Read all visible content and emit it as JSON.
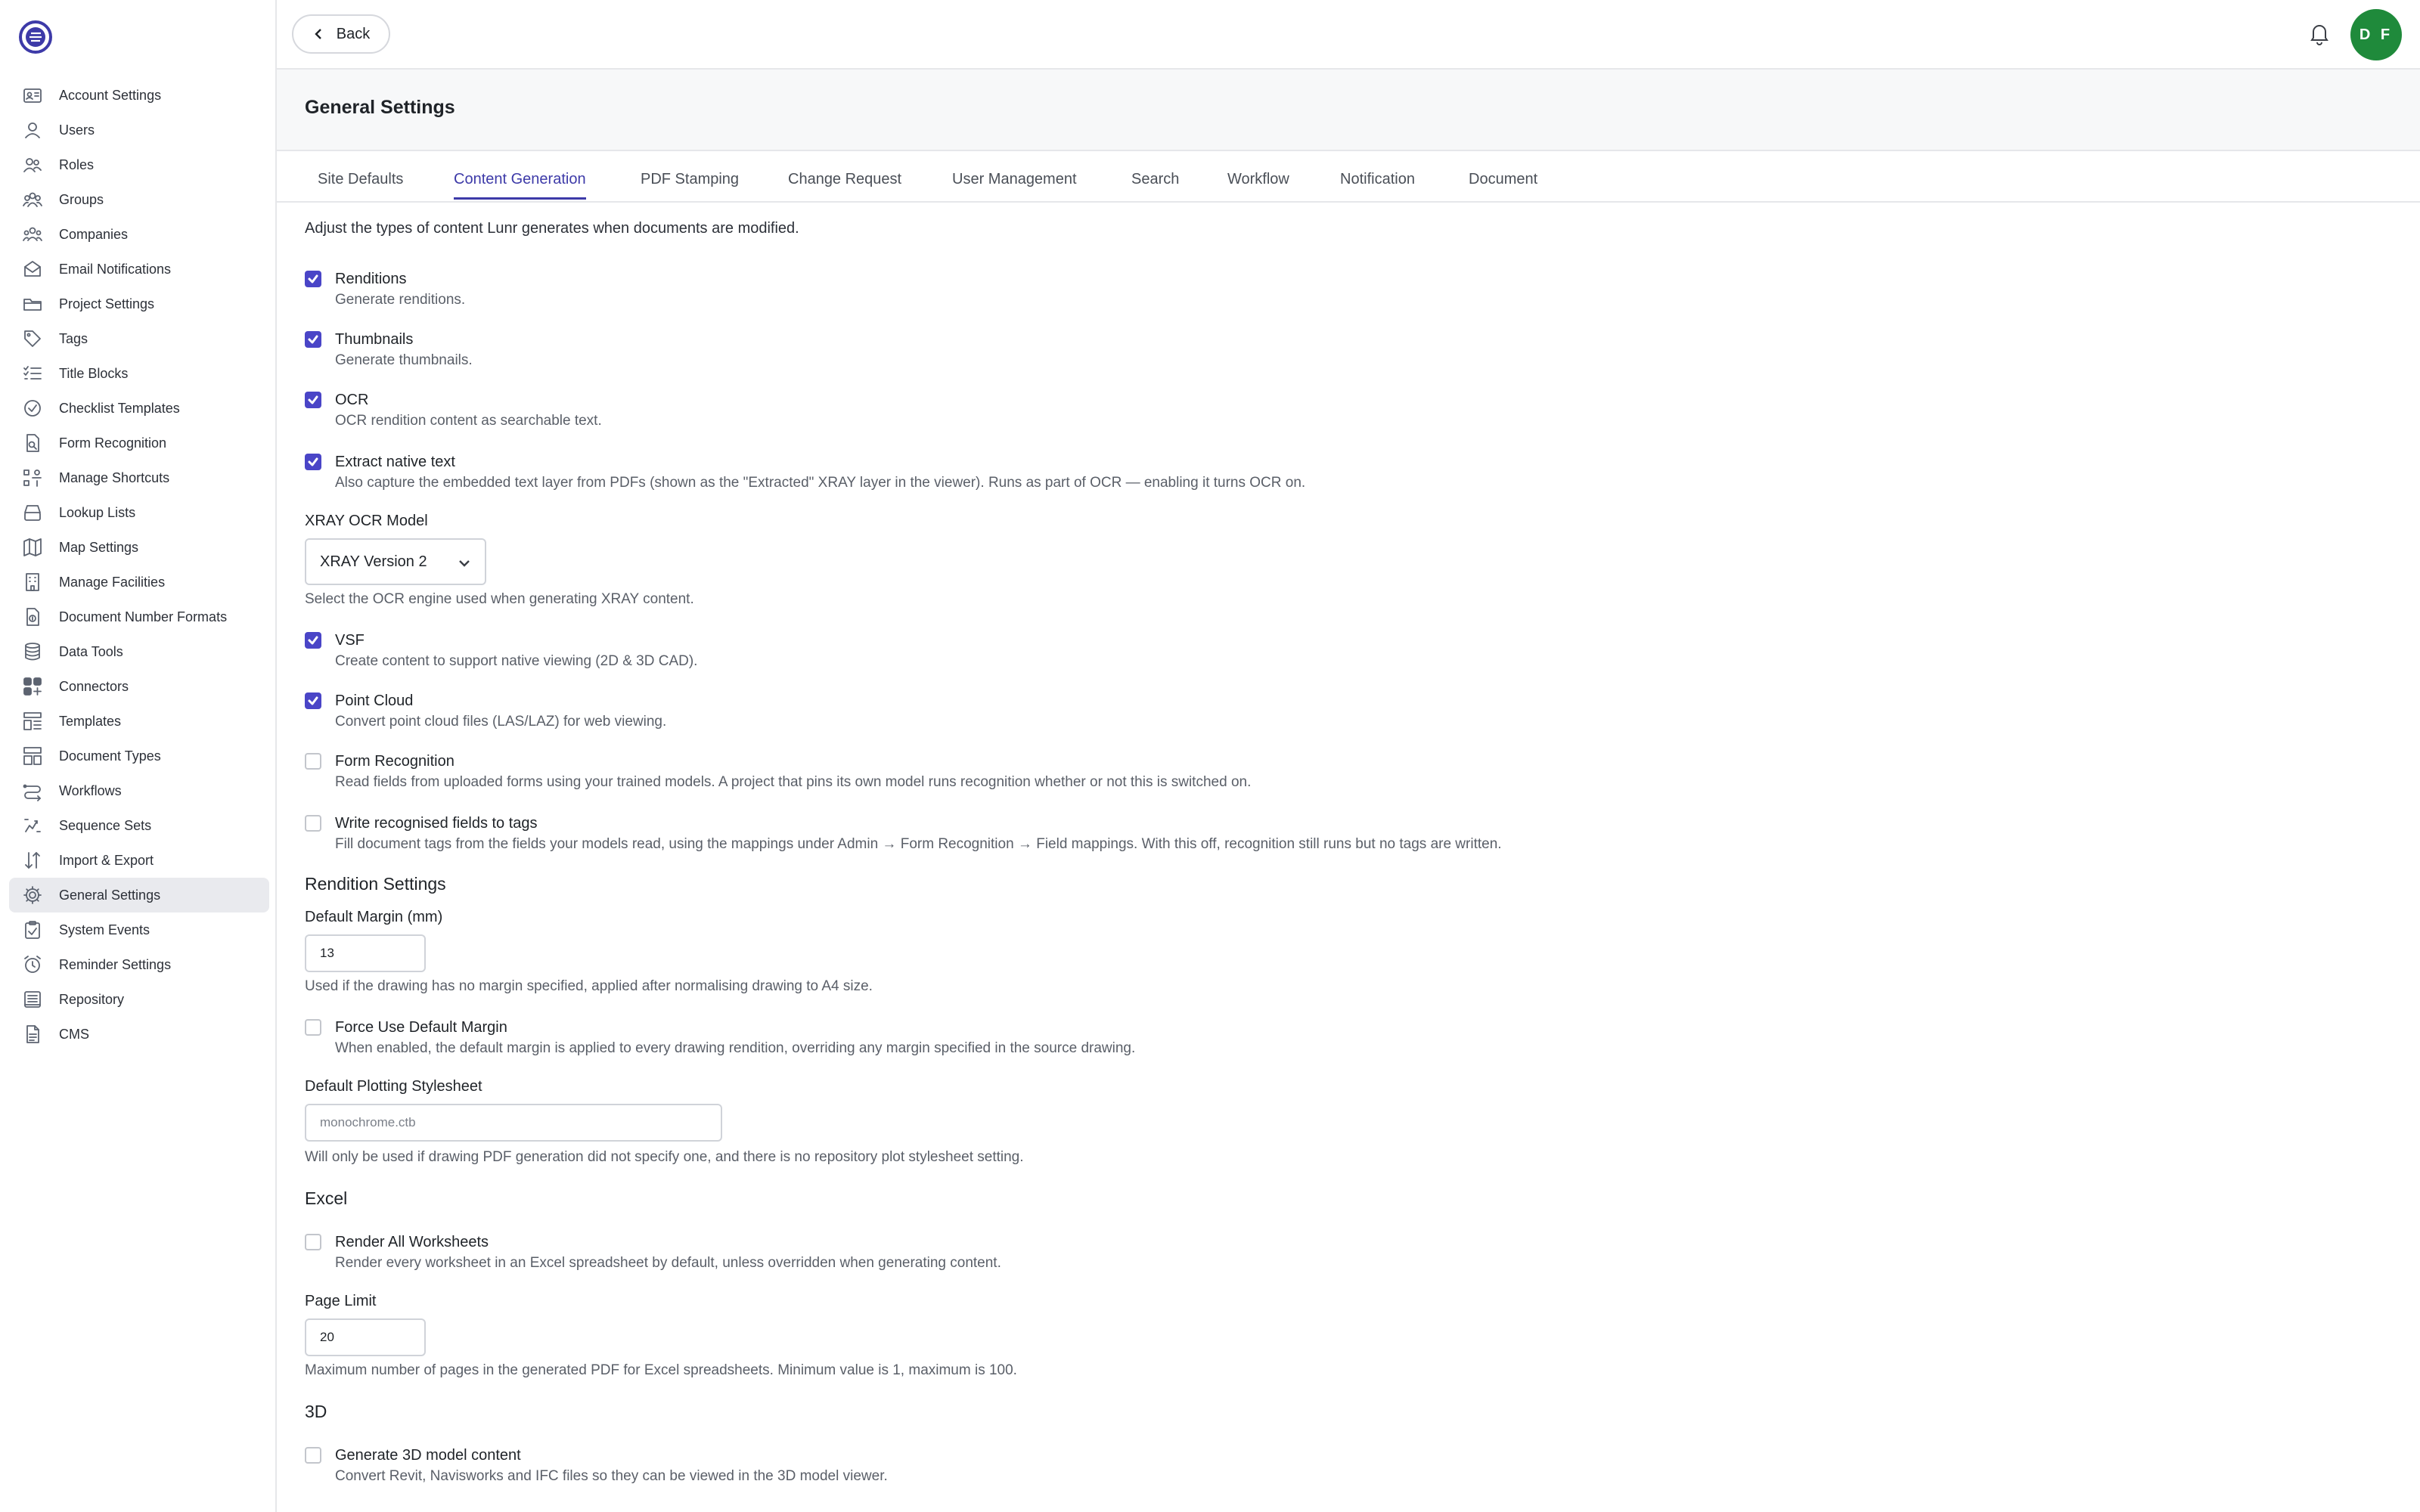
{
  "sidebar": {
    "items": [
      {
        "label": "Account Settings",
        "icon": "account-card-icon"
      },
      {
        "label": "Users",
        "icon": "user-icon"
      },
      {
        "label": "Roles",
        "icon": "roles-icon"
      },
      {
        "label": "Groups",
        "icon": "groups-icon"
      },
      {
        "label": "Companies",
        "icon": "companies-icon"
      },
      {
        "label": "Email Notifications",
        "icon": "envelope-icon"
      },
      {
        "label": "Project Settings",
        "icon": "folder-icon"
      },
      {
        "label": "Tags",
        "icon": "tag-icon"
      },
      {
        "label": "Title Blocks",
        "icon": "list-icon"
      },
      {
        "label": "Checklist Templates",
        "icon": "check-circle-icon"
      },
      {
        "label": "Form Recognition",
        "icon": "document-search-icon"
      },
      {
        "label": "Manage Shortcuts",
        "icon": "shortcuts-icon"
      },
      {
        "label": "Lookup Lists",
        "icon": "tray-icon"
      },
      {
        "label": "Map Settings",
        "icon": "map-icon"
      },
      {
        "label": "Manage Facilities",
        "icon": "building-icon"
      },
      {
        "label": "Document Number Formats",
        "icon": "document-number-icon"
      },
      {
        "label": "Data Tools",
        "icon": "database-icon"
      },
      {
        "label": "Connectors",
        "icon": "grid-plus-icon"
      },
      {
        "label": "Templates",
        "icon": "template-icon"
      },
      {
        "label": "Document Types",
        "icon": "layout-icon"
      },
      {
        "label": "Workflows",
        "icon": "workflow-icon"
      },
      {
        "label": "Sequence Sets",
        "icon": "sequence-icon"
      },
      {
        "label": "Import & Export",
        "icon": "arrows-up-down-icon"
      },
      {
        "label": "General Settings",
        "icon": "gear-icon"
      },
      {
        "label": "System Events",
        "icon": "clipboard-check-icon"
      },
      {
        "label": "Reminder Settings",
        "icon": "alarm-clock-icon"
      },
      {
        "label": "Repository",
        "icon": "repository-icon"
      },
      {
        "label": "CMS",
        "icon": "file-text-icon"
      }
    ],
    "active_index": 23
  },
  "topbar": {
    "back_label": "Back",
    "avatar_initials": "D F"
  },
  "header": {
    "title": "General Settings"
  },
  "tabs": [
    {
      "label": "Site Defaults"
    },
    {
      "label": "Content Generation"
    },
    {
      "label": "PDF Stamping"
    },
    {
      "label": "Change Request"
    },
    {
      "label": "User Management"
    },
    {
      "label": "Search"
    },
    {
      "label": "Workflow"
    },
    {
      "label": "Notification"
    },
    {
      "label": "Document"
    }
  ],
  "active_tab": 1,
  "content": {
    "intro": "Adjust the types of content Lunr generates when documents are modified.",
    "renditions": {
      "label": "Renditions",
      "desc": "Generate renditions.",
      "checked": true
    },
    "thumbnails": {
      "label": "Thumbnails",
      "desc": "Generate thumbnails.",
      "checked": true
    },
    "ocr": {
      "label": "OCR",
      "desc": "OCR rendition content as searchable text.",
      "checked": true
    },
    "extract_native": {
      "label": "Extract native text",
      "desc": "Also capture the embedded text layer from PDFs (shown as the \"Extracted\" XRAY layer in the viewer). Runs as part of OCR — enabling it turns OCR on.",
      "checked": true
    },
    "xray_model": {
      "label": "XRAY OCR Model",
      "value": "XRAY Version 2",
      "help": "Select the OCR engine used when generating XRAY content."
    },
    "vsf": {
      "label": "VSF",
      "desc": "Create content to support native viewing (2D & 3D CAD).",
      "checked": true
    },
    "point_cloud": {
      "label": "Point Cloud",
      "desc": "Convert point cloud files (LAS/LAZ) for web viewing.",
      "checked": true
    },
    "form_recognition": {
      "label": "Form Recognition",
      "desc": "Read fields from uploaded forms using your trained models. A project that pins its own model runs recognition whether or not this is switched on.",
      "checked": false
    },
    "write_fields": {
      "label": "Write recognised fields to tags",
      "desc": "Fill document tags from the fields your models read, using the mappings under Admin → Form Recognition → Field mappings. With this off, recognition still runs but no tags are written.",
      "checked": false
    },
    "rendition_section": "Rendition Settings",
    "default_margin": {
      "label": "Default Margin (mm)",
      "value": "13",
      "help": "Used if the drawing has no margin specified, applied after normalising drawing to A4 size."
    },
    "force_margin": {
      "label": "Force Use Default Margin",
      "desc": "When enabled, the default margin is applied to every drawing rendition, overriding any margin specified in the source drawing.",
      "checked": false
    },
    "stylesheet": {
      "label": "Default Plotting Stylesheet",
      "placeholder": "monochrome.ctb",
      "help": "Will only be used if drawing PDF generation did not specify one, and there is no repository plot stylesheet setting."
    },
    "excel_section": "Excel",
    "render_all": {
      "label": "Render All Worksheets",
      "desc": "Render every worksheet in an Excel spreadsheet by default, unless overridden when generating content.",
      "checked": false
    },
    "page_limit": {
      "label": "Page Limit",
      "value": "20",
      "help": "Maximum number of pages in the generated PDF for Excel spreadsheets. Minimum value is 1, maximum is 100."
    },
    "threed_section": "3D",
    "generate_3d": {
      "label": "Generate 3D model content",
      "desc": "Convert Revit, Navisworks and IFC files so they can be viewed in the 3D model viewer.",
      "checked": false
    }
  },
  "colors": {
    "accent": "#4a45c7",
    "avatar": "#1f8a3b",
    "active_nav": "#e9eaee"
  }
}
